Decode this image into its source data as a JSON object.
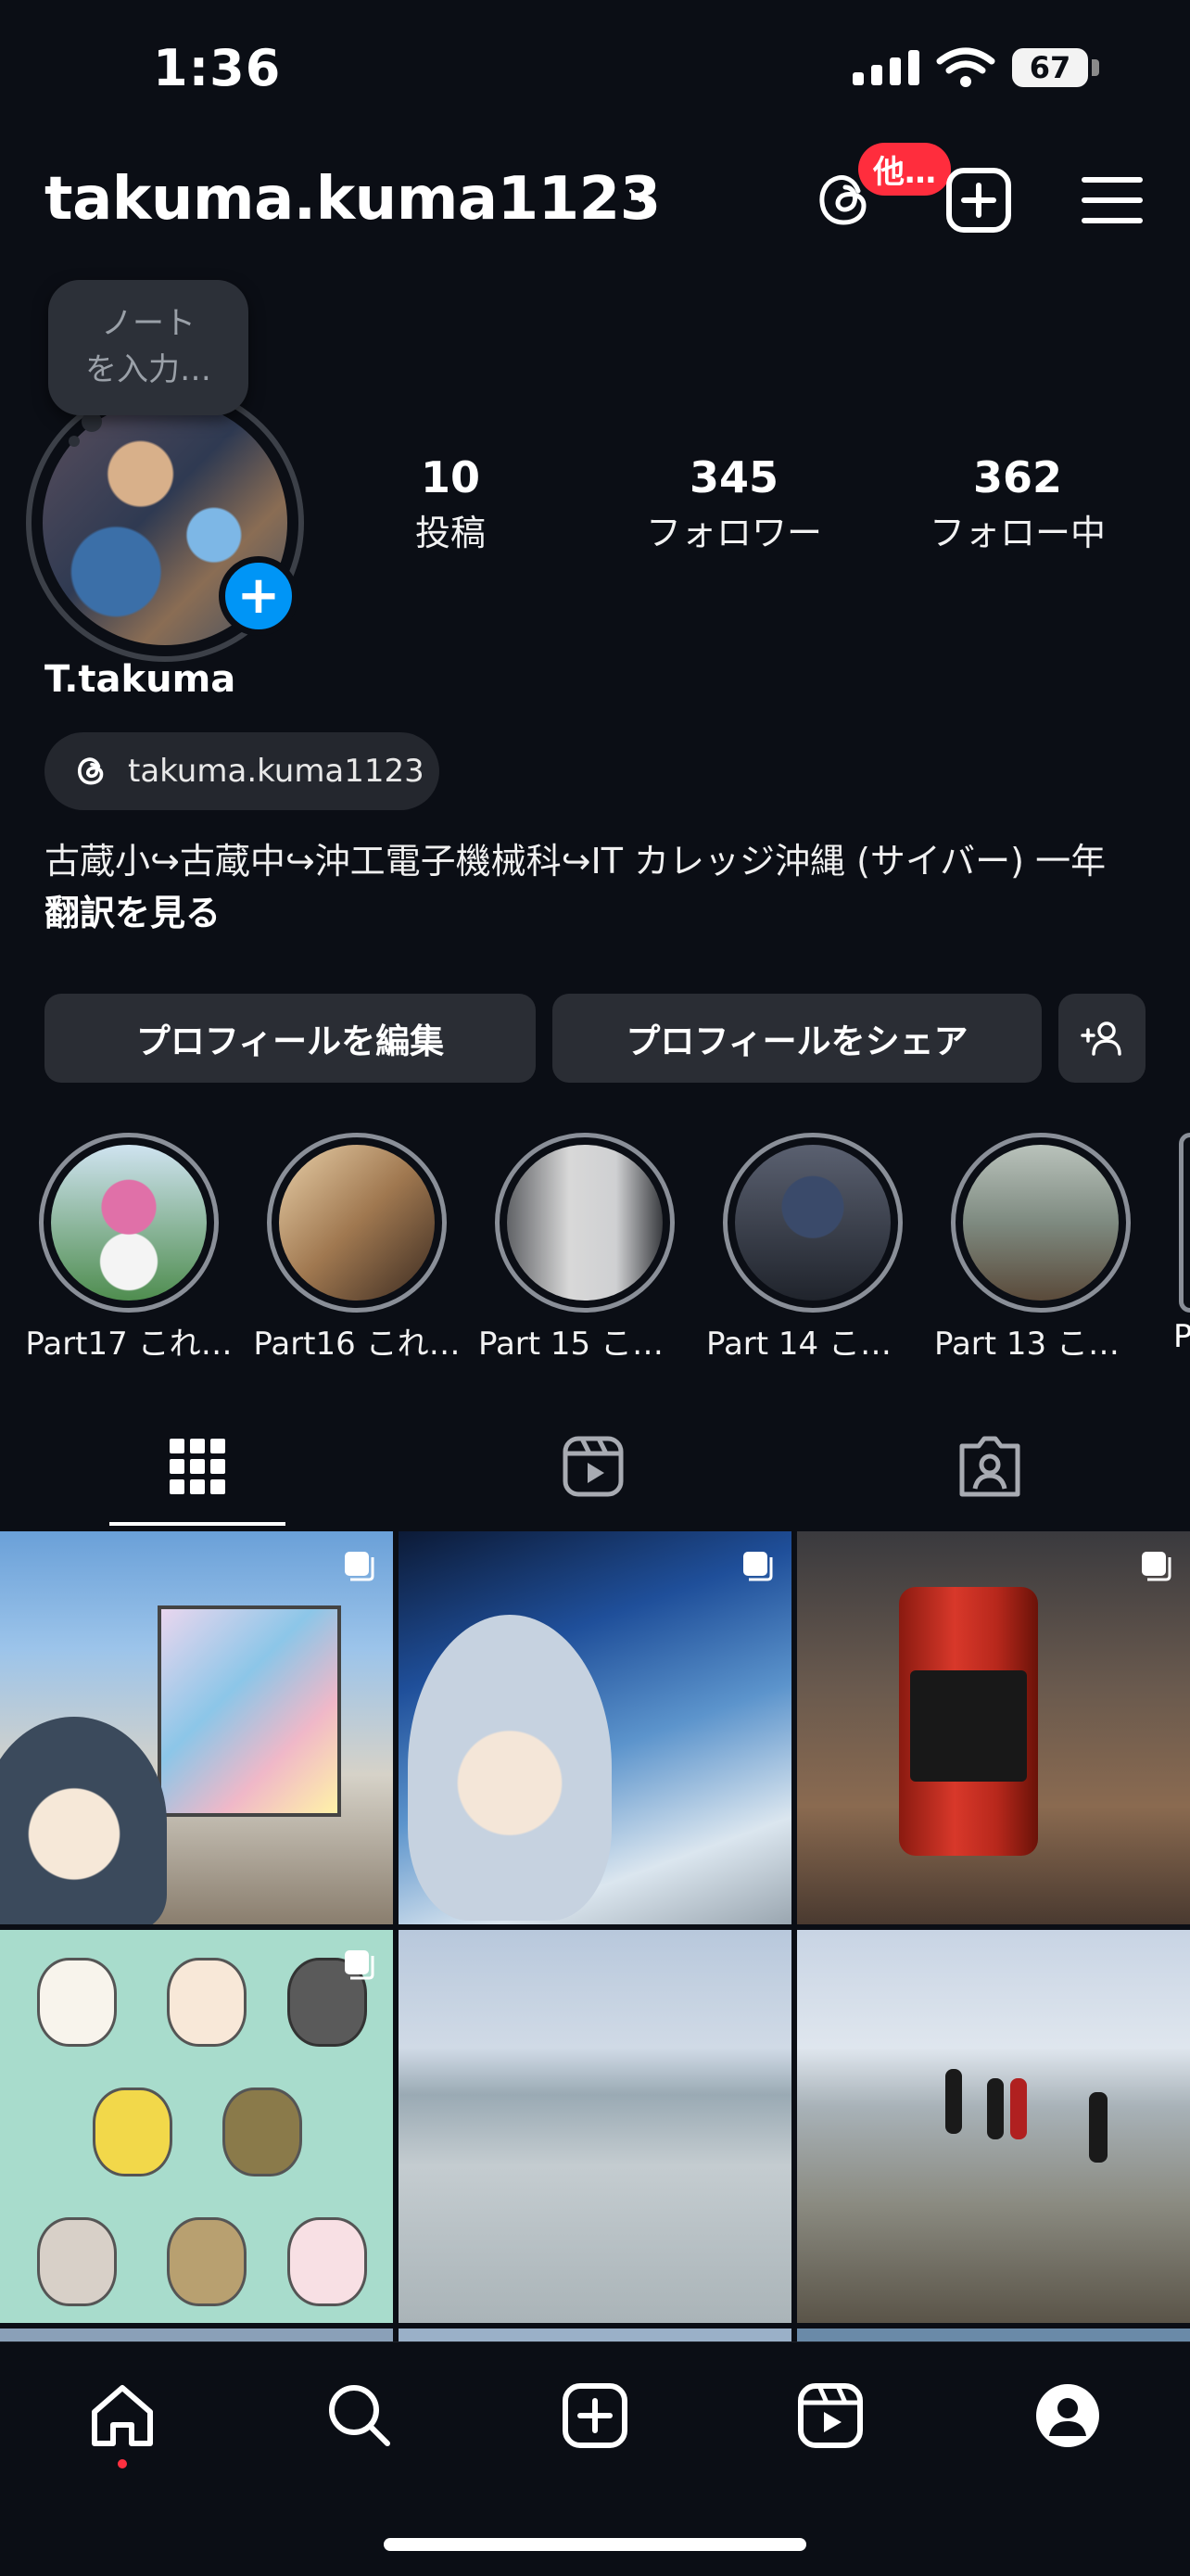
{
  "status_bar": {
    "time": "1:36",
    "battery": "67"
  },
  "header": {
    "username": "takuma.kuma1123",
    "threads_badge": "他…",
    "icons": [
      "threads-icon",
      "create-plus-icon",
      "menu-icon"
    ]
  },
  "note": {
    "placeholder": "ノート\nを入力…"
  },
  "profile": {
    "display_name": "T.takuma",
    "threads_handle": "takuma.kuma1123",
    "bio": "古蔵小↪︎古蔵中↪︎沖工電子機械科↪︎IT カレッジ沖縄 (サイバー) 一年",
    "translate": "翻訳を見る"
  },
  "stats": {
    "posts": {
      "value": "10",
      "label": "投稿"
    },
    "followers": {
      "value": "345",
      "label": "フォロワー"
    },
    "following": {
      "value": "362",
      "label": "フォロー中"
    }
  },
  "actions": {
    "edit": "プロフィールを編集",
    "share": "プロフィールをシェア"
  },
  "highlights": [
    {
      "label": "Part17 これ…"
    },
    {
      "label": "Part16 これ…"
    },
    {
      "label": "Part 15 これ…"
    },
    {
      "label": "Part 14 これ…"
    },
    {
      "label": "Part 13 これ…"
    },
    {
      "label": "P"
    }
  ],
  "tabs": [
    "grid-icon",
    "reels-icon",
    "tagged-icon"
  ],
  "posts": [
    {
      "multi": true
    },
    {
      "multi": true
    },
    {
      "multi": true
    },
    {
      "multi": true
    },
    {
      "multi": false
    },
    {
      "multi": false
    }
  ],
  "bottom_nav": [
    "home-icon",
    "search-icon",
    "create-icon",
    "reels-icon",
    "profile-icon"
  ]
}
